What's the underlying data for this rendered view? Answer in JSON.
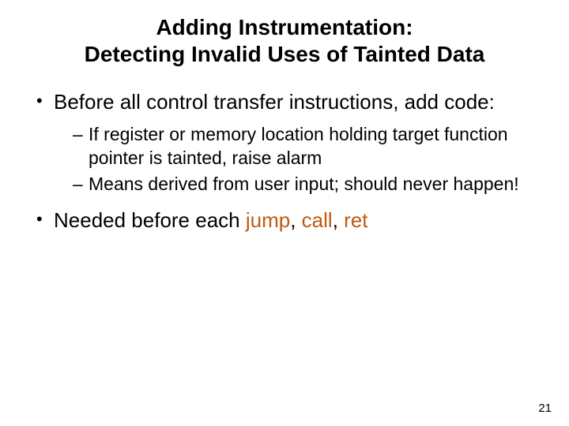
{
  "title_line1": "Adding Instrumentation:",
  "title_line2": "Detecting Invalid Uses of Tainted Data",
  "bullets": {
    "b1": "Before all control transfer instructions, add code:",
    "b1_sub1": "If register or memory location holding target function pointer is tainted, raise alarm",
    "b1_sub2": "Means derived from user input; should never happen!",
    "b2_prefix": "Needed before each ",
    "b2_kw1": "jump",
    "b2_sep1": ", ",
    "b2_kw2": "call",
    "b2_sep2": ", ",
    "b2_kw3": "ret"
  },
  "page_number": "21"
}
